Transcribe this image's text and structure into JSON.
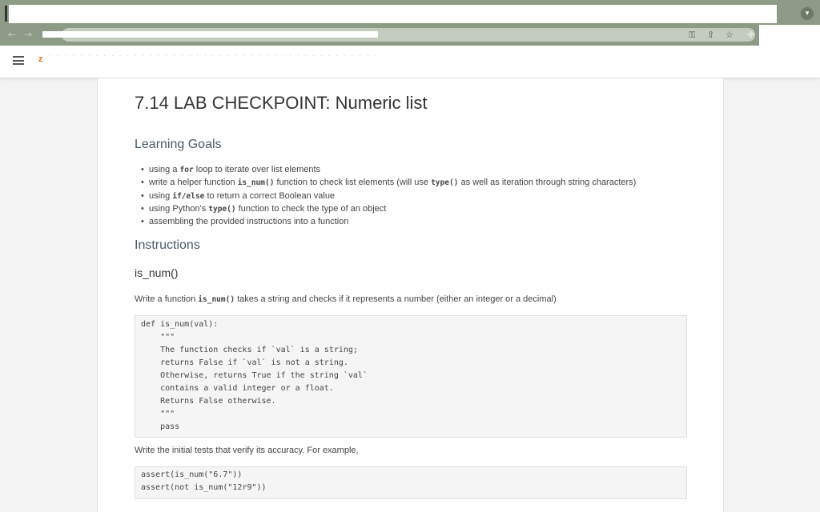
{
  "browser": {
    "chrome_menu_icon": "chevron-down-icon",
    "toolbar_icons": [
      "back-arrow-icon",
      "forward-arrow-icon",
      "key-icon",
      "share-icon",
      "star-icon",
      "puzzle-icon"
    ]
  },
  "page": {
    "title": "7.14 LAB CHECKPOINT: Numeric list",
    "learning_goals_heading": "Learning Goals",
    "goals": [
      {
        "pre": "using a ",
        "code": "for",
        "post": " loop to iterate over list elements"
      },
      {
        "pre": "write a helper function ",
        "code": "is_num()",
        "post": " function to check list elements (will use ",
        "code2": "type()",
        "post2": " as well as iteration through string characters)"
      },
      {
        "pre": "using ",
        "code": "if/else",
        "post": " to return a correct Boolean value"
      },
      {
        "pre": "using Python's ",
        "code": "type()",
        "post": " function to check the type of an object"
      },
      {
        "pre": "assembling the provided instructions into a function",
        "code": "",
        "post": ""
      }
    ],
    "instructions_heading": "Instructions",
    "subheading": "is_num()",
    "intro": {
      "pre": "Write a function ",
      "code": "is_num()",
      "post": " takes a string and checks if it represents a number (either an integer or a decimal)"
    },
    "code_block_1": [
      "def is_num(val):",
      "    \"\"\"",
      "    The function checks if `val` is a string;",
      "    returns False if `val` is not a string.",
      "    Otherwise, returns True if the string `val`",
      "    contains a valid integer or a float.",
      "    Returns False otherwise.",
      "    \"\"\"",
      "    pass"
    ],
    "tests_intro": "Write the initial tests that verify its accuracy. For example,",
    "code_block_2": [
      "assert(is_num(\"6.7\"))",
      "assert(not is_num(\"12r9\"))"
    ]
  }
}
